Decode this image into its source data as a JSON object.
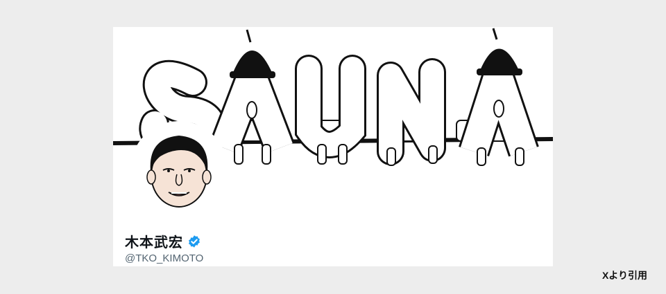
{
  "profile": {
    "display_name": "木本武宏",
    "handle": "@TKO_KIMOTO",
    "verified_icon": "verified-badge-icon",
    "verified_color": "#1d9bf0",
    "banner_text": "SAUNA"
  },
  "credit": "Xより引用"
}
